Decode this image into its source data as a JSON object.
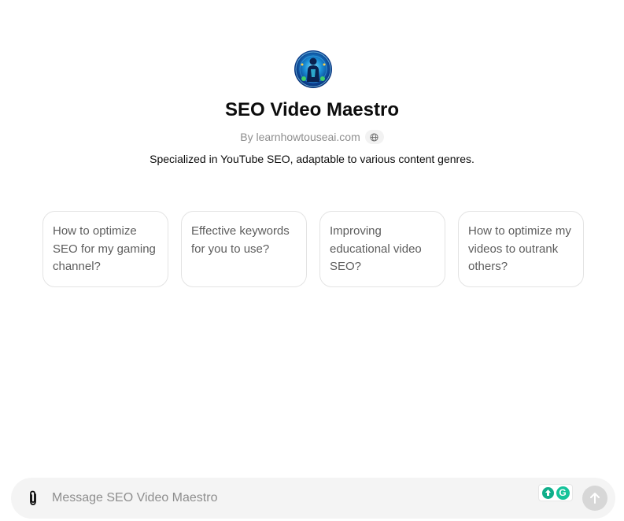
{
  "gpt": {
    "name": "SEO Video Maestro",
    "author": "By learnhowtouseai.com",
    "description": "Specialized in YouTube SEO, adaptable to various content genres.",
    "avatar_icon": "robot-figure-avatar",
    "author_link_icon": "globe-icon"
  },
  "prompts": [
    "How to optimize SEO for my gaming channel?",
    "Effective keywords for you to use?",
    "Improving educational video SEO?",
    "How to optimize my videos to outrank others?"
  ],
  "composer": {
    "placeholder": "Message SEO Video Maestro",
    "value": "",
    "attach_icon": "paperclip-icon",
    "send_icon": "arrow-up-icon",
    "extensions": [
      "upload-extension-icon",
      "grammarly-icon"
    ],
    "grammarly_letter": "G"
  },
  "colors": {
    "card_border": "#e3e3e3",
    "composer_bg": "#f4f4f4",
    "send_disabled": "#d7d7d7",
    "grammarly": "#15c39a"
  }
}
